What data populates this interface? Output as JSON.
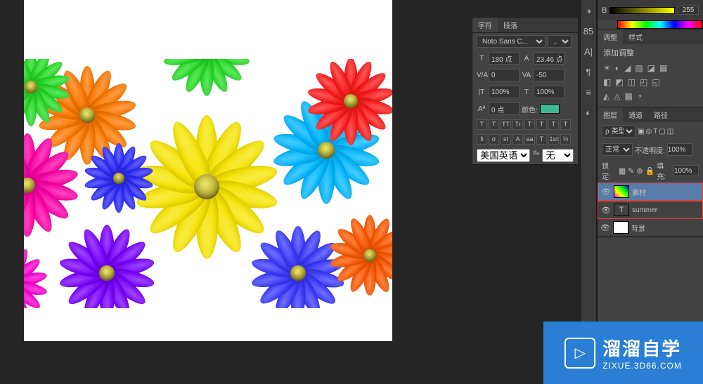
{
  "color_picker": {
    "channel": "B",
    "value": "255"
  },
  "char_panel": {
    "tabs": [
      "字符",
      "段落"
    ],
    "font_family": "Noto Sans C...",
    "font_style": "...",
    "size_icon": "T",
    "size": "180 点",
    "leading_icon": "A",
    "leading": "23.46 点",
    "va_label": "V/A",
    "va_value": "0",
    "tracking_label": "VA",
    "tracking_value": "-50",
    "scale_h": "100%",
    "scale_v": "100%",
    "baseline_label": "Aª",
    "baseline": "0 点",
    "color_label": "颜色:",
    "style_buttons_1": [
      "T",
      "T",
      "TT",
      "Tr",
      "T",
      "T",
      "T",
      "T"
    ],
    "style_buttons_2": [
      "fi",
      "σ",
      "st",
      "A",
      "aa",
      "T",
      "1st",
      "½"
    ],
    "lang": "美国英语",
    "aa_label": "aₐ",
    "aa_value": "无"
  },
  "adjustments": {
    "tabs": [
      "调整",
      "样式"
    ],
    "title": "添加调整",
    "row1": [
      "☀",
      "◐",
      "◢",
      "▨",
      "◪",
      "▦"
    ],
    "row2": [
      "◧",
      "◩",
      "◫",
      "◰",
      "◱"
    ],
    "row3": [
      "◭",
      "◬",
      "▩",
      "◔"
    ]
  },
  "layers": {
    "tabs": [
      "图层",
      "通道",
      "路径"
    ],
    "kind": "ρ 类型",
    "kind_icons": [
      "▣",
      "◎",
      "T",
      "▢",
      "◫"
    ],
    "blend": "正常",
    "opacity_label": "不透明度:",
    "opacity": "100%",
    "lock_label": "锁定:",
    "lock_icons": [
      "▦",
      "✎",
      "⊕",
      "🔒"
    ],
    "fill_label": "填充:",
    "fill": "100%",
    "items": [
      {
        "name": "素材",
        "type": "image",
        "visible": true
      },
      {
        "name": "summer",
        "type": "text",
        "visible": true
      },
      {
        "name": "背景",
        "type": "bg",
        "visible": true
      }
    ]
  },
  "strip_icons": [
    "◑",
    "85",
    "A|",
    "¶",
    "≡",
    "◐"
  ],
  "watermark": {
    "main": "溜溜自学",
    "sub": "ZIXUE.3D66.COM"
  }
}
